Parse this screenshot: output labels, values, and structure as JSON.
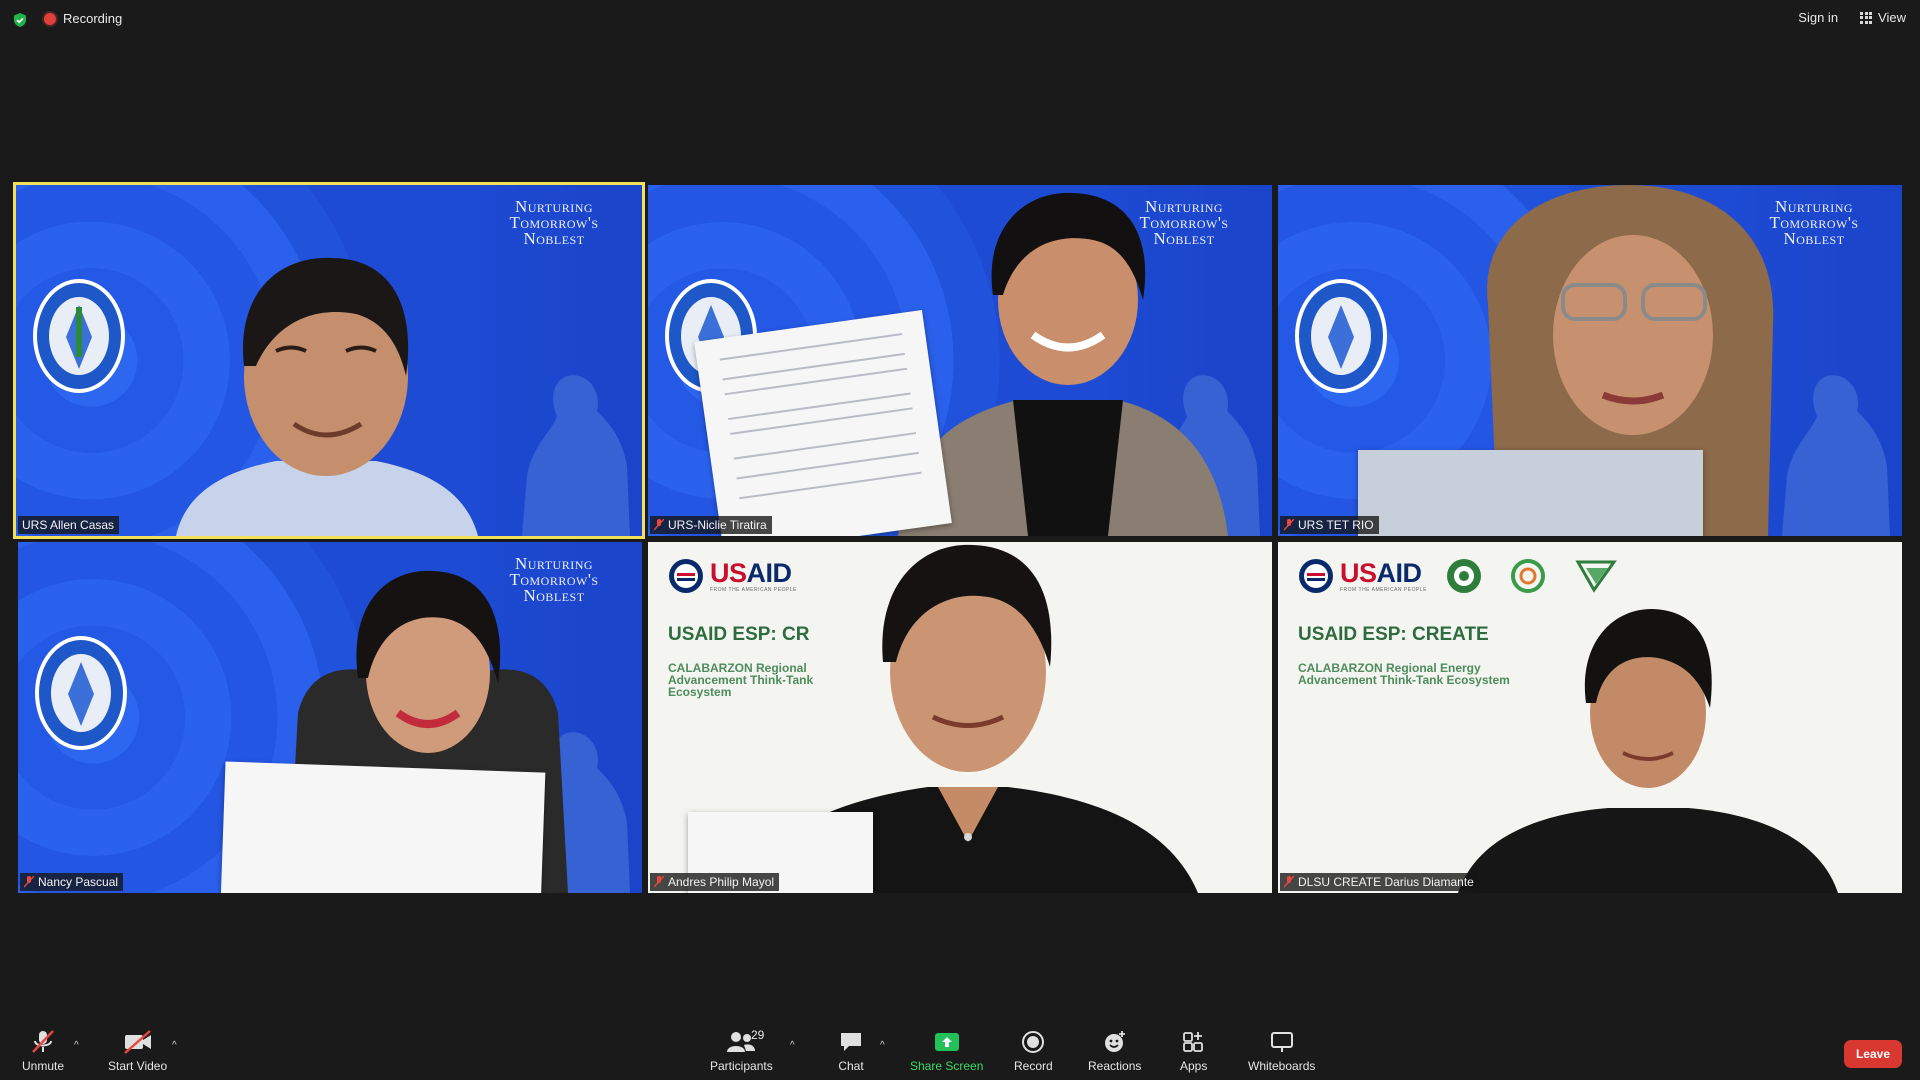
{
  "topbar": {
    "recording_label": "Recording",
    "sign_in_label": "Sign in",
    "view_label": "View"
  },
  "slogan": {
    "line1": "Nurturing",
    "line2": "Tomorrow's",
    "line3": "Noblest"
  },
  "usaid": {
    "word_u": "US",
    "word_rest": "AID",
    "tagline": "FROM THE AMERICAN PEOPLE",
    "title_full": "USAID ESP: CREATE",
    "title_cut": "USAID ESP: CR",
    "subtitle_full": "CALABARZON Regional Energy Advancement Think-Tank Ecosystem",
    "subtitle_cut": "CALABARZON Regional Advancement Think-Tank Ecosystem"
  },
  "participants": [
    {
      "name": "URS Allen Casas",
      "muted": false,
      "active_speaker": true
    },
    {
      "name": "URS-Niclie Tiratira",
      "muted": true
    },
    {
      "name": "URS TET RIO",
      "muted": true
    },
    {
      "name": "Nancy Pascual",
      "muted": true
    },
    {
      "name": "Andres Philip Mayol",
      "muted": true
    },
    {
      "name": "DLSU CREATE Darius Diamante",
      "muted": true
    }
  ],
  "toolbar": {
    "unmute_label": "Unmute",
    "start_video_label": "Start Video",
    "participants_label": "Participants",
    "participants_count": "29",
    "chat_label": "Chat",
    "share_screen_label": "Share Screen",
    "record_label": "Record",
    "reactions_label": "Reactions",
    "apps_label": "Apps",
    "whiteboards_label": "Whiteboards",
    "leave_label": "Leave",
    "caret": "^"
  },
  "colors": {
    "background": "#1a1a1a",
    "active_speaker_border": "#f2e05a",
    "share_green": "#3ddc66",
    "leave_red": "#d93831",
    "recording_red": "#e0403b"
  }
}
